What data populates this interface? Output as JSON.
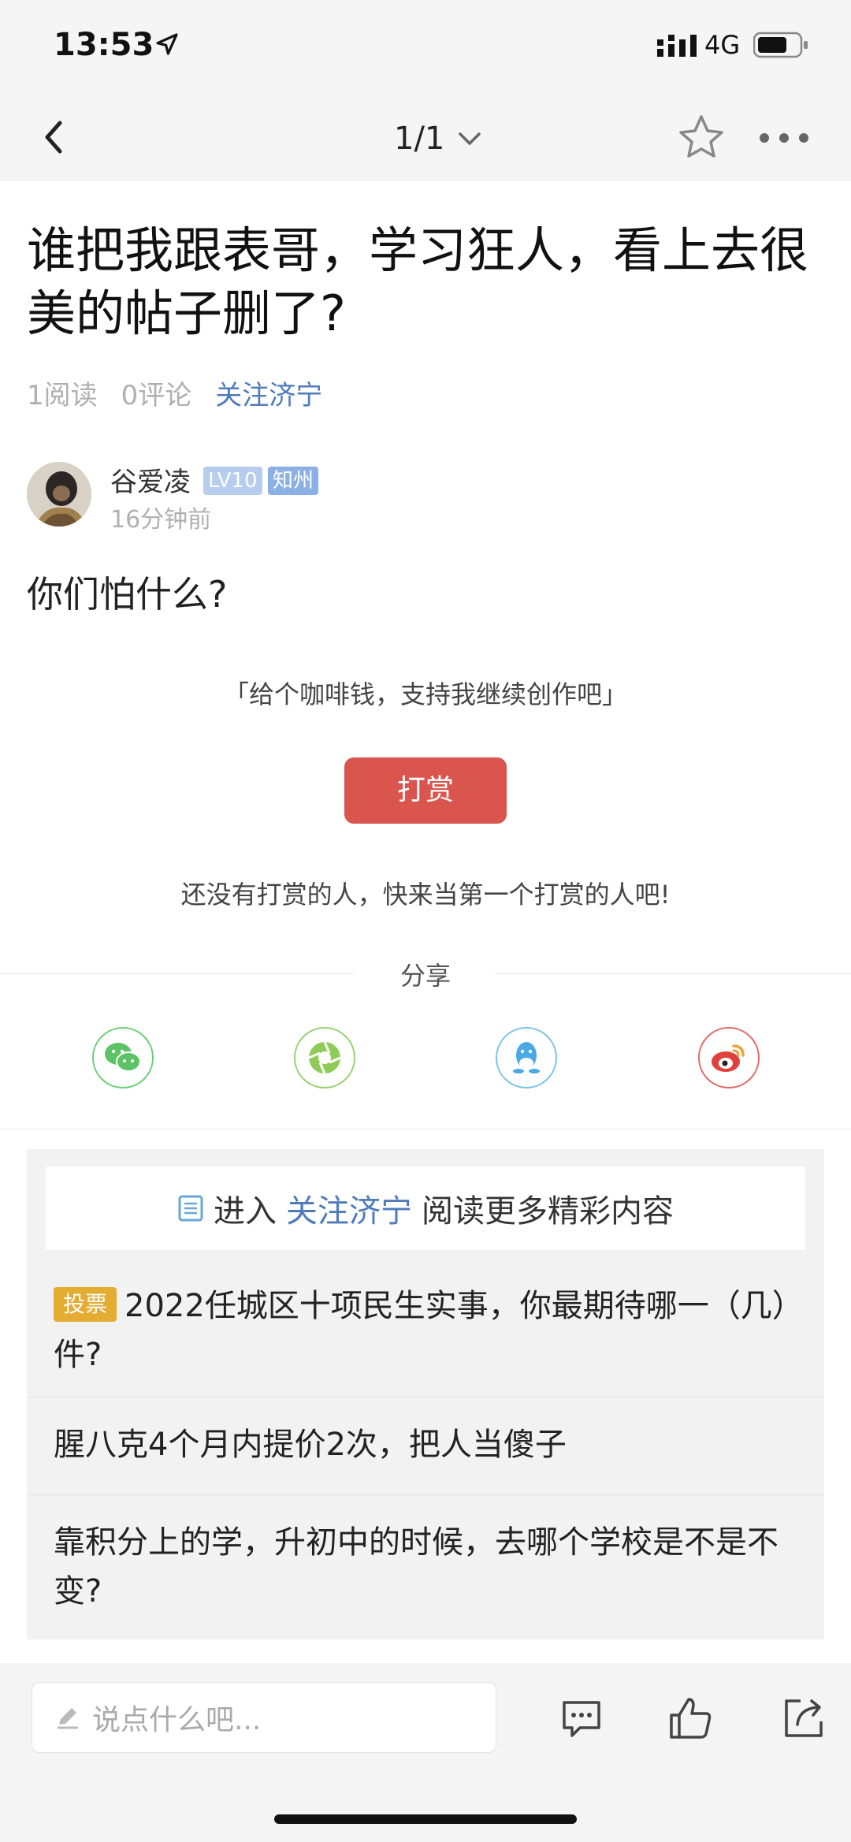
{
  "status_bar": {
    "time": "13:53",
    "network": "4G"
  },
  "nav": {
    "page_indicator": "1/1"
  },
  "post": {
    "title": "谁把我跟表哥，学习狂人，看上去很美的帖子删了?",
    "reads": "1阅读",
    "comments": "0评论",
    "forum_link": "关注济宁",
    "author": {
      "name": "谷爱凌",
      "level_badge": "LV10",
      "location_badge": "知州",
      "time": "16分钟前"
    },
    "content": "你们怕什么?"
  },
  "tip": {
    "quote": "「给个咖啡钱，支持我继续创作吧」",
    "button_label": "打赏",
    "empty_text": "还没有打赏的人，快来当第一个打赏的人吧!"
  },
  "share": {
    "title": "分享",
    "items": [
      {
        "icon": "wechat-icon",
        "color": "#6ccf75"
      },
      {
        "icon": "moments-icon",
        "color": "#97d070"
      },
      {
        "icon": "qq-icon",
        "color": "#7cc4ea"
      },
      {
        "icon": "weibo-icon",
        "color": "#e26b66"
      }
    ]
  },
  "related": {
    "enter_prefix": "进入",
    "enter_link": "关注济宁",
    "enter_suffix": "阅读更多精彩内容",
    "items": [
      {
        "tag": "投票",
        "text": "2022任城区十项民生实事，你最期待哪一（几）件?"
      },
      {
        "text": "腥八克4个月内提价2次，把人当傻子"
      },
      {
        "text": "靠积分上的学，升初中的时候，去哪个学校是不是不变?"
      }
    ]
  },
  "bottom_bar": {
    "comment_placeholder": "说点什么吧..."
  },
  "colors": {
    "accent_link": "#4f7bbd",
    "tip_button": "#d9554e",
    "vote_tag": "#e5ac33"
  }
}
